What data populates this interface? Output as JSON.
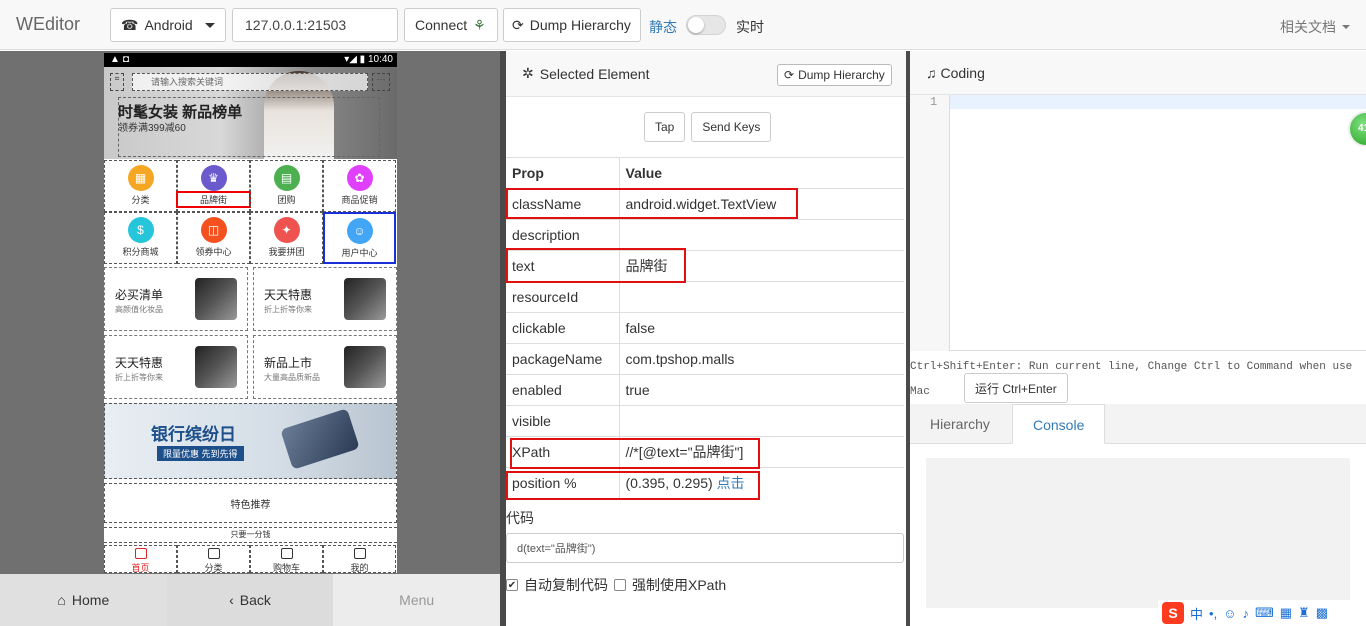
{
  "app": {
    "title": "WEditor"
  },
  "toolbar": {
    "platform": "Android",
    "address": "127.0.0.1:21503",
    "connect_label": "Connect",
    "dump_label": "Dump Hierarchy",
    "mode_static": "静态",
    "mode_realtime": "实时",
    "docs_label": "相关文档"
  },
  "device": {
    "status_time": "10:40",
    "search_placeholder": "请输入搜索关键词",
    "hero_title": "时髦女装 新品榜单",
    "hero_sub": "领券满399减60",
    "grid": [
      {
        "label": "分类",
        "color": "#f5a623",
        "icon": "▦"
      },
      {
        "label": "品牌街",
        "color": "#6a5acd",
        "icon": "♛"
      },
      {
        "label": "团购",
        "color": "#4caf50",
        "icon": "▤"
      },
      {
        "label": "商品促销",
        "color": "#e040fb",
        "icon": "✿"
      },
      {
        "label": "积分商城",
        "color": "#26c6da",
        "icon": "$"
      },
      {
        "label": "领券中心",
        "color": "#f4511e",
        "icon": "◫"
      },
      {
        "label": "我要拼团",
        "color": "#ef5350",
        "icon": "✦"
      },
      {
        "label": "用户中心",
        "color": "#42a5f5",
        "icon": "☺"
      }
    ],
    "promos": [
      {
        "title": "必买清单",
        "sub": "高颜值化妆品"
      },
      {
        "title": "天天特惠",
        "sub": "折上折等你来"
      },
      {
        "title": "天天特惠",
        "sub": "折上折等你来"
      },
      {
        "title": "新品上市",
        "sub": "大量高品质新品"
      }
    ],
    "bank_title": "银行缤纷日",
    "bank_sub": "限量优惠 先到先得",
    "special": "特色推荐",
    "only_one": "只要一分钱",
    "nav": [
      "首页",
      "分类",
      "购物车",
      "我的"
    ],
    "bottom": {
      "home": "Home",
      "back": "Back",
      "menu": "Menu"
    }
  },
  "selected": {
    "title": "Selected Element",
    "dump_label": "Dump Hierarchy",
    "tap_label": "Tap",
    "sendkeys_label": "Send Keys",
    "col_prop": "Prop",
    "col_value": "Value",
    "rows": [
      {
        "k": "className",
        "v": "android.widget.TextView"
      },
      {
        "k": "description",
        "v": ""
      },
      {
        "k": "text",
        "v": "品牌街"
      },
      {
        "k": "resourceId",
        "v": ""
      },
      {
        "k": "clickable",
        "v": "false"
      },
      {
        "k": "packageName",
        "v": "com.tpshop.malls"
      },
      {
        "k": "enabled",
        "v": "true"
      },
      {
        "k": "visible",
        "v": ""
      },
      {
        "k": "XPath",
        "v": "//*[@text=\"品牌街\"]"
      },
      {
        "k": "position %",
        "v": "(0.395, 0.295)",
        "link": "点击"
      }
    ],
    "code_label": "代码",
    "code_value": "d(text=\"品牌街\")",
    "auto_copy": "自动复制代码",
    "force_xpath": "强制使用XPath"
  },
  "coding": {
    "title": "Coding",
    "line_no": "1",
    "hint": "Ctrl+Shift+Enter: Run current line, Change Ctrl to Command when use Mac",
    "run_label": "运行 Ctrl+Enter",
    "tab_hierarchy": "Hierarchy",
    "tab_console": "Console",
    "badge": "41"
  },
  "ime": {
    "brand": "S",
    "lang": "中"
  }
}
